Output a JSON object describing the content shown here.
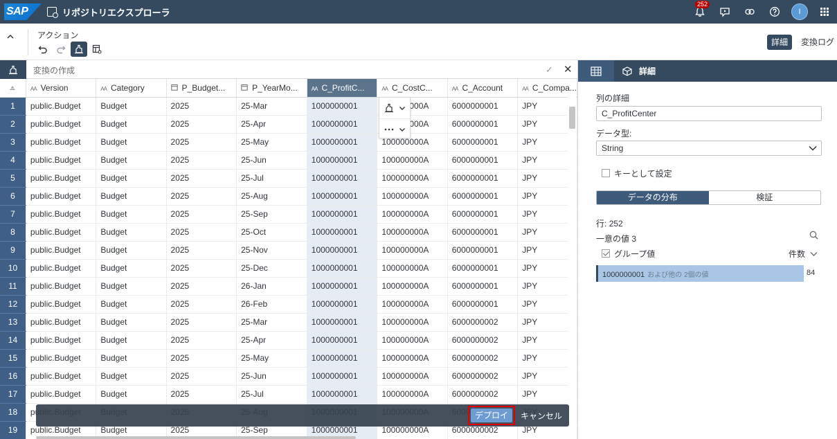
{
  "shell": {
    "logo": "SAP",
    "title": "リポジトリエクスプローラ",
    "notification_count": "252",
    "avatar_initial": "I"
  },
  "toolbar": {
    "section_label": "アクション",
    "detail_label": "詳細",
    "changelog_label": "変換ログ"
  },
  "formula": {
    "placeholder": "変換の作成"
  },
  "grid": {
    "columns": [
      {
        "type": "AA",
        "label": "Version"
      },
      {
        "type": "AA",
        "label": "Category"
      },
      {
        "type": "date",
        "label": "P_Budget..."
      },
      {
        "type": "date",
        "label": "P_YearMo..."
      },
      {
        "type": "AA",
        "label": "C_ProfitC..."
      },
      {
        "type": "AA",
        "label": "C_CostC..."
      },
      {
        "type": "AA",
        "label": "C_Account"
      },
      {
        "type": "AA",
        "label": "C_Compa..."
      }
    ],
    "rows": [
      [
        "1",
        "public.Budget",
        "Budget",
        "2025",
        "25-Mar",
        "1000000001",
        "100000000A",
        "6000000001",
        "JPY"
      ],
      [
        "2",
        "public.Budget",
        "Budget",
        "2025",
        "25-Apr",
        "1000000001",
        "100000000A",
        "6000000001",
        "JPY"
      ],
      [
        "3",
        "public.Budget",
        "Budget",
        "2025",
        "25-May",
        "1000000001",
        "100000000A",
        "6000000001",
        "JPY"
      ],
      [
        "4",
        "public.Budget",
        "Budget",
        "2025",
        "25-Jun",
        "1000000001",
        "100000000A",
        "6000000001",
        "JPY"
      ],
      [
        "5",
        "public.Budget",
        "Budget",
        "2025",
        "25-Jul",
        "1000000001",
        "100000000A",
        "6000000001",
        "JPY"
      ],
      [
        "6",
        "public.Budget",
        "Budget",
        "2025",
        "25-Aug",
        "1000000001",
        "100000000A",
        "6000000001",
        "JPY"
      ],
      [
        "7",
        "public.Budget",
        "Budget",
        "2025",
        "25-Sep",
        "1000000001",
        "100000000A",
        "6000000001",
        "JPY"
      ],
      [
        "8",
        "public.Budget",
        "Budget",
        "2025",
        "25-Oct",
        "1000000001",
        "100000000A",
        "6000000001",
        "JPY"
      ],
      [
        "9",
        "public.Budget",
        "Budget",
        "2025",
        "25-Nov",
        "1000000001",
        "100000000A",
        "6000000001",
        "JPY"
      ],
      [
        "10",
        "public.Budget",
        "Budget",
        "2025",
        "25-Dec",
        "1000000001",
        "100000000A",
        "6000000001",
        "JPY"
      ],
      [
        "11",
        "public.Budget",
        "Budget",
        "2025",
        "26-Jan",
        "1000000001",
        "100000000A",
        "6000000001",
        "JPY"
      ],
      [
        "12",
        "public.Budget",
        "Budget",
        "2025",
        "26-Feb",
        "1000000001",
        "100000000A",
        "6000000001",
        "JPY"
      ],
      [
        "13",
        "public.Budget",
        "Budget",
        "2025",
        "25-Mar",
        "1000000001",
        "100000000A",
        "6000000002",
        "JPY"
      ],
      [
        "14",
        "public.Budget",
        "Budget",
        "2025",
        "25-Apr",
        "1000000001",
        "100000000A",
        "6000000002",
        "JPY"
      ],
      [
        "15",
        "public.Budget",
        "Budget",
        "2025",
        "25-May",
        "1000000001",
        "100000000A",
        "6000000002",
        "JPY"
      ],
      [
        "16",
        "public.Budget",
        "Budget",
        "2025",
        "25-Jun",
        "1000000001",
        "100000000A",
        "6000000002",
        "JPY"
      ],
      [
        "17",
        "public.Budget",
        "Budget",
        "2025",
        "25-Jul",
        "1000000001",
        "100000000A",
        "6000000002",
        "JPY"
      ],
      [
        "18",
        "public.Budget",
        "Budget",
        "2025",
        "25-Aug",
        "1000000001",
        "100000000A",
        "6000000002",
        "JPY"
      ],
      [
        "19",
        "public.Budget",
        "Budget",
        "2025",
        "25-Sep",
        "1000000001",
        "100000000A",
        "6000000002",
        "JPY"
      ]
    ]
  },
  "deploy_bar": {
    "deploy_label": "デプロイ",
    "cancel_label": "キャンセル"
  },
  "panel": {
    "tab_label": "詳細",
    "column_details_label": "列の詳細",
    "column_name": "C_ProfitCenter",
    "data_type_label": "データ型:",
    "data_type_value": "String",
    "key_checkbox_label": "キーとして設定",
    "seg_distribution": "データの分布",
    "seg_validation": "検証",
    "rows_label": "行:",
    "rows_value": "252",
    "unique_label": "一意の値",
    "unique_value": "3",
    "group_values_label": "グループ値",
    "count_label": "件数",
    "bar_value": "1000000001",
    "bar_suffix": "および他の 2個の値",
    "bar_count": "84"
  }
}
